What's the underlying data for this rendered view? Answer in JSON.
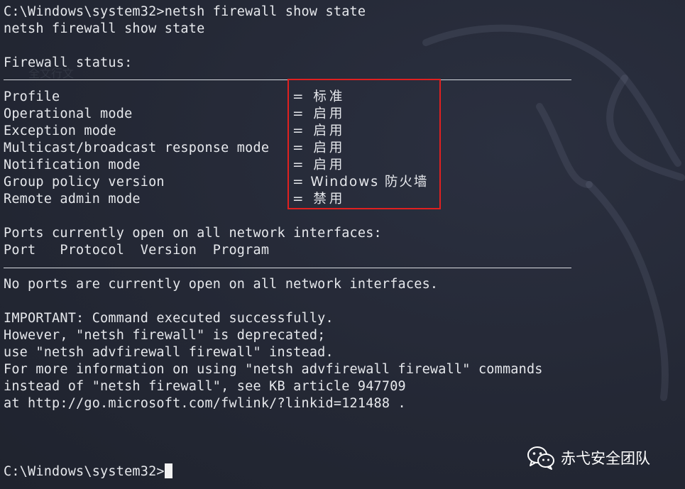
{
  "terminal": {
    "commands": {
      "prompt_cmd": "C:\\Windows\\system32>netsh firewall show state",
      "echo": "netsh firewall show state"
    },
    "firewall_status_header": "Firewall status:",
    "settings": [
      {
        "label": "Profile",
        "value": "= 标准"
      },
      {
        "label": "Operational mode",
        "value": "= 启用"
      },
      {
        "label": "Exception mode",
        "value": "= 启用"
      },
      {
        "label": "Multicast/broadcast response mode",
        "value": "= 启用"
      },
      {
        "label": "Notification mode",
        "value": "= 启用"
      },
      {
        "label": "Group policy version",
        "value": "= Windows 防火墙"
      },
      {
        "label": "Remote admin mode",
        "value": "= 禁用"
      }
    ],
    "ports_header": "Ports currently open on all network interfaces:",
    "ports_columns": "Port   Protocol  Version  Program",
    "no_ports": "No ports are currently open on all network interfaces.",
    "important": [
      "IMPORTANT: Command executed successfully.",
      "However, \"netsh firewall\" is deprecated;",
      "use \"netsh advfirewall firewall\" instead.",
      "For more information on using \"netsh advfirewall firewall\" commands",
      "instead of \"netsh firewall\", see KB article 947709",
      "at http://go.microsoft.com/fwlink/?linkid=121488 ."
    ],
    "final_prompt": "C:\\Windows\\system32>"
  },
  "watermark": {
    "text": "赤弋安全团队",
    "icon": "wechat-icon"
  },
  "colors": {
    "background": "#232734",
    "text": "#e6e8ec",
    "highlight_box": "#e02020"
  }
}
